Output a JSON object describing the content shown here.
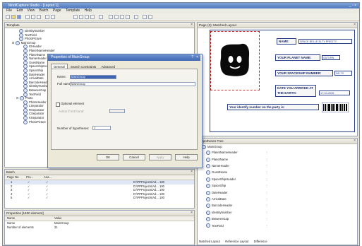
{
  "window": {
    "title": "ModiCapture Studio - [Layout 1]",
    "controls": "_ ▫ ×"
  },
  "menubar": [
    "File",
    "Edit",
    "View",
    "Batch",
    "Page",
    "Template",
    "Help"
  ],
  "template_panel": {
    "title": "Template",
    "items": [
      "IdentityNumber",
      "TextField",
      "PhotoPicture",
      "MainGroup",
      "IDHeader",
      "PlanetNameHeader",
      "PlanetName",
      "NameHeader",
      "GuestName",
      "SpaceShipHeader",
      "SpaceShip",
      "DateHeader",
      "ArrivalDate",
      "BarcodeHeader",
      "IdentityNumber",
      "BetweenGap",
      "TextField",
      "Photo",
      "PhotoHeader",
      "LSeparator",
      "RSeparator",
      "CSeparator",
      "KSeparator",
      "PhotoPicture"
    ]
  },
  "batch_panel": {
    "title": "Batch",
    "headers": [
      "Page No.",
      "Pro...",
      "Ana..."
    ],
    "rows": [
      {
        "page": "1",
        "col2": "✓",
        "col3": "✓",
        "path": "D:\\PPProjects\\Ad... 100"
      },
      {
        "page": "2",
        "col2": "✓",
        "col3": "✓",
        "path": "D:\\PPProjects\\Ad... 100"
      },
      {
        "page": "3",
        "col2": "✓",
        "col3": "✓",
        "path": "D:\\PPProjects\\Ad... 100"
      },
      {
        "page": "4",
        "col2": "✓",
        "col3": "✓",
        "path": "D:\\PPProjects\\Ad... 100"
      },
      {
        "page": "5",
        "col2": "✓",
        "col3": "✓",
        "path": "D:\\PPProjects\\Ad... 100"
      }
    ]
  },
  "properties_panel": {
    "title": "Properties [1400 element]",
    "headers": [
      "Name",
      "Value"
    ],
    "rows": [
      {
        "name": "Name",
        "value": "MainGroup"
      },
      {
        "name": "Number of elements",
        "value": "21"
      }
    ]
  },
  "dialog": {
    "title": "Properties of MainGroup",
    "tabs": [
      "General",
      "Search constraints",
      "Advanced"
    ],
    "name_label": "Name:",
    "name_value": "MainGroup",
    "fullname_label": "Full name:",
    "fullname_value": "MainGroup",
    "optional_label": "Optional element",
    "action_label": "Action if not found:",
    "hypotheses_label": "Number of hypotheses:",
    "hypotheses_value": "1",
    "ok": "OK",
    "cancel": "Cancel",
    "apply": "Apply",
    "help": "Help"
  },
  "page_panel": {
    "title": "Page (3): Matched Layout",
    "fields": [
      {
        "label": "NAME:",
        "value": "SPACE BELLE ELTY PREDTY"
      },
      {
        "label": "YOUR PLANET NAME:",
        "value": "SATURN"
      },
      {
        "label": "YOUR SPACESHIP NUMBER:",
        "value": "NS-73"
      },
      {
        "label": "DATE YOU ARRIVED AT THE EARTH:",
        "value": "17-04-2006"
      }
    ],
    "identity_label": "Your identify number on the party is:"
  },
  "hypotheses_panel": {
    "title": "Hypotheses Tree",
    "root": "MainGroup",
    "items": [
      "PlanetNameHeader",
      "PlanetName",
      "NameHeader",
      "GuestName",
      "SpaceShipHeader",
      "SpaceShip",
      "DateHeader",
      "ArrivalDate",
      "BarcodeHeader",
      "IdentityNumber",
      "BetweenGap",
      "TextField"
    ],
    "bottom_tabs": [
      "Matched Layout",
      "Reference Layout",
      "Difference"
    ]
  }
}
